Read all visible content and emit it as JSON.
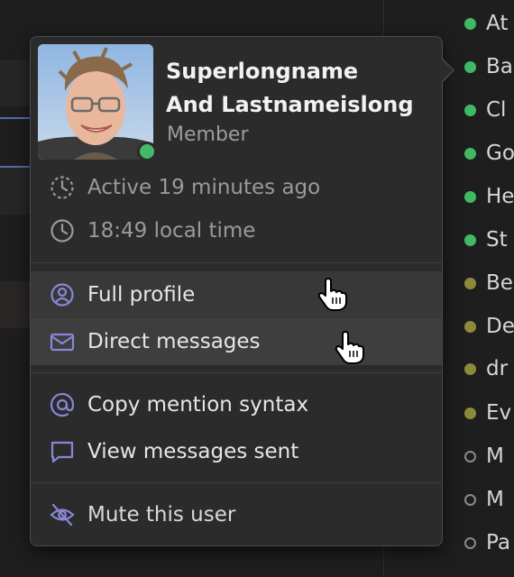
{
  "user_list": [
    {
      "name": "At",
      "status": "active"
    },
    {
      "name": "Ba",
      "status": "active"
    },
    {
      "name": "Cl",
      "status": "active"
    },
    {
      "name": "Go",
      "status": "active"
    },
    {
      "name": "He",
      "status": "active"
    },
    {
      "name": "St",
      "status": "active"
    },
    {
      "name": "Be",
      "status": "idle"
    },
    {
      "name": "De",
      "status": "idle"
    },
    {
      "name": "dr",
      "status": "idle"
    },
    {
      "name": "Ev",
      "status": "idle"
    },
    {
      "name": "M",
      "status": "offline"
    },
    {
      "name": "M",
      "status": "offline"
    },
    {
      "name": "Pa",
      "status": "offline"
    }
  ],
  "profile": {
    "name_line1": "Superlongname",
    "name_line2": "And Lastnameislong",
    "role": "Member",
    "active": "Active 19 minutes ago",
    "local_time": "18:49 local time"
  },
  "menu": {
    "full_profile": "Full profile",
    "direct_messages": "Direct messages",
    "copy_mention": "Copy mention syntax",
    "view_messages": "View messages sent",
    "mute": "Mute this user"
  },
  "colors": {
    "accent_icon": "#8a86d8",
    "presence_active": "#44b96a",
    "presence_idle": "#8c8a3a"
  }
}
